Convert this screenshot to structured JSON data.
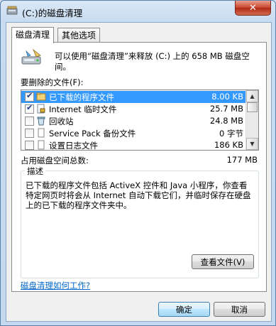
{
  "window": {
    "title": "(C:)的磁盘清理",
    "close_glyph": "✕"
  },
  "tabs": [
    {
      "label": "磁盘清理",
      "active": true
    },
    {
      "label": "其他选项",
      "active": false
    }
  ],
  "intro": {
    "text": "可以使用“磁盘清理”来释放 (C:) 上的 658 MB 磁盘空间。",
    "icon": "drive-cleanup-icon"
  },
  "files": {
    "label": "要删除的文件(F):",
    "items": [
      {
        "name": "已下载的程序文件",
        "size": "8.00 KB",
        "checked": true,
        "selected": true,
        "icon": "folder-icon"
      },
      {
        "name": "Internet 临时文件",
        "size": "25.7 MB",
        "checked": true,
        "selected": false,
        "icon": "lock-file-icon"
      },
      {
        "name": "回收站",
        "size": "24.8 MB",
        "checked": false,
        "selected": false,
        "icon": "recycle-bin-icon"
      },
      {
        "name": "Service Pack 备份文件",
        "size": "0 字节",
        "checked": false,
        "selected": false,
        "icon": "file-icon"
      },
      {
        "name": "设置日志文件",
        "size": "186 KB",
        "checked": false,
        "selected": false,
        "icon": "file-icon"
      }
    ]
  },
  "total": {
    "label": "占用磁盘空间总数:",
    "value": "177 MB"
  },
  "description": {
    "legend": "描述",
    "text": "已下载的程序文件包括 ActiveX 控件和 Java 小程序，你查看特定网页时将会从 Internet 自动下载它们，并临时保存在硬盘上的已下载的程序文件夹中。",
    "view_files_label": "查看文件(V)"
  },
  "help_link": "磁盘清理如何工作?",
  "buttons": {
    "ok": "确定",
    "cancel": "取消"
  },
  "colors": {
    "selection": "#3399ff",
    "link": "#0066cc",
    "close": "#c9432c"
  }
}
